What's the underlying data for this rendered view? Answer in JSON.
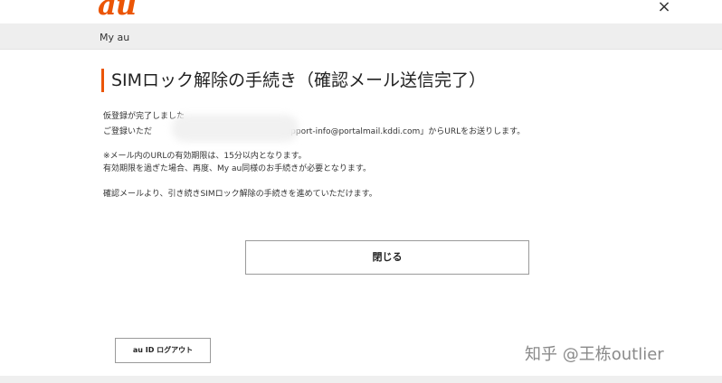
{
  "header": {
    "logo_text": "au",
    "close_icon": "close-icon",
    "close_glyph": "×",
    "brand_color": "#eb5505"
  },
  "nav": {
    "my_au": "My au"
  },
  "main": {
    "title": "SIMロック解除の手続き（確認メール送信完了）",
    "line1": "仮登録が完了しました",
    "line2_prefix": "ご登録いただ",
    "line2_suffix": "「support-info@portalmail.kddi.com」からURLをお送りします。",
    "note1": "※メール内のURLの有効期限は、15分以内となります。",
    "note2": "有効期限を過ぎた場合、再度、My au同様のお手続きが必要となります。",
    "instruction": "確認メールより、引き続きSIMロック解除の手続きを進めていただけます。",
    "close_button": "閉じる"
  },
  "footer": {
    "logout_button": "au ID ログアウト"
  },
  "watermark": "知乎 @王栋outlier"
}
